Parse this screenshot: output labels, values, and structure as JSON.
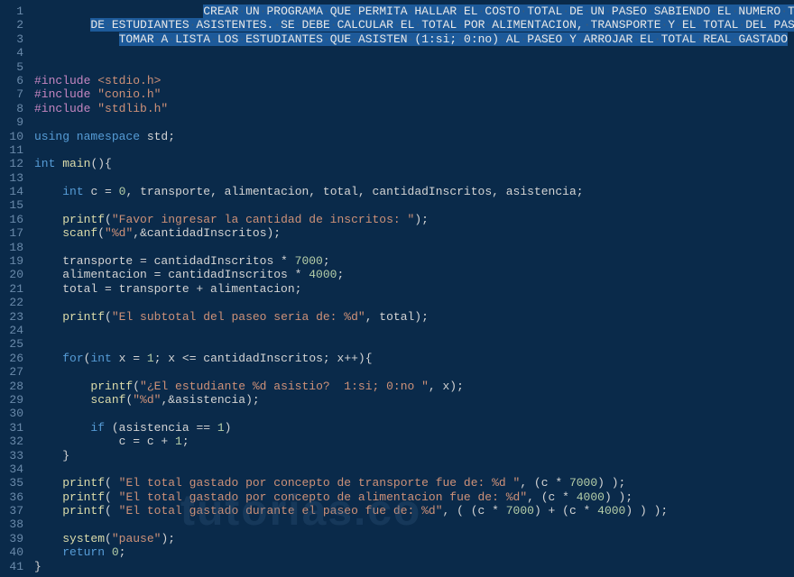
{
  "watermark": "tutorias.co",
  "lines": [
    {
      "num": 1,
      "selected": true,
      "content": [
        {
          "t": "sel",
          "v": "CREAR·UN·PROGRAMA·QUE·PERMITA·HALLAR·EL·COSTO·TOTAL·DE·UN·PASEO·SABIENDO·EL·NUMERO·TOTAL"
        }
      ],
      "indent": "                        "
    },
    {
      "num": 2,
      "selected": true,
      "content": [
        {
          "t": "sel",
          "v": "DE·ESTUDIANTES·ASISTENTES.·SE·DEBE·CALCULAR·EL·TOTAL·POR·ALIMENTACION,·TRANSPORTE·Y·EL·TOTAL·DEL·PASEO"
        }
      ],
      "indent": "        "
    },
    {
      "num": 3,
      "selected": true,
      "content": [
        {
          "t": "sel",
          "v": "TOMAR·A·LISTA·LOS·ESTUDIANTES·QUE·ASISTEN·(1:si;·0:no)·AL·PASEO·Y·ARROJAR·EL·TOTAL·REAL·GASTADO"
        }
      ],
      "indent": "            "
    },
    {
      "num": 4,
      "content": []
    },
    {
      "num": 5,
      "content": []
    },
    {
      "num": 6,
      "content": [
        {
          "t": "preproc",
          "v": "#include "
        },
        {
          "t": "include-path",
          "v": "<stdio.h>"
        }
      ]
    },
    {
      "num": 7,
      "content": [
        {
          "t": "preproc",
          "v": "#include "
        },
        {
          "t": "include-path",
          "v": "\"conio.h\""
        }
      ]
    },
    {
      "num": 8,
      "content": [
        {
          "t": "preproc",
          "v": "#include "
        },
        {
          "t": "include-path",
          "v": "\"stdlib.h\""
        }
      ]
    },
    {
      "num": 9,
      "content": []
    },
    {
      "num": 10,
      "content": [
        {
          "t": "keyword",
          "v": "using namespace "
        },
        {
          "t": "ident",
          "v": "std;"
        }
      ]
    },
    {
      "num": 11,
      "content": []
    },
    {
      "num": 12,
      "content": [
        {
          "t": "type",
          "v": "int "
        },
        {
          "t": "func",
          "v": "main"
        },
        {
          "t": "paren",
          "v": "(){"
        }
      ]
    },
    {
      "num": 13,
      "content": []
    },
    {
      "num": 14,
      "content": [
        {
          "t": "ident",
          "v": "    "
        },
        {
          "t": "type",
          "v": "int "
        },
        {
          "t": "ident",
          "v": "c = "
        },
        {
          "t": "number",
          "v": "0"
        },
        {
          "t": "ident",
          "v": ", transporte, alimentacion, total, cantidadInscritos, asistencia;"
        }
      ]
    },
    {
      "num": 15,
      "content": []
    },
    {
      "num": 16,
      "content": [
        {
          "t": "ident",
          "v": "    "
        },
        {
          "t": "func",
          "v": "printf"
        },
        {
          "t": "paren",
          "v": "("
        },
        {
          "t": "string",
          "v": "\"Favor ingresar la cantidad de inscritos: \""
        },
        {
          "t": "paren",
          "v": ");"
        }
      ]
    },
    {
      "num": 17,
      "content": [
        {
          "t": "ident",
          "v": "    "
        },
        {
          "t": "func",
          "v": "scanf"
        },
        {
          "t": "paren",
          "v": "("
        },
        {
          "t": "string",
          "v": "\"%d\""
        },
        {
          "t": "ident",
          "v": ",&cantidadInscritos);"
        }
      ]
    },
    {
      "num": 18,
      "content": []
    },
    {
      "num": 19,
      "content": [
        {
          "t": "ident",
          "v": "    transporte = cantidadInscritos * "
        },
        {
          "t": "number",
          "v": "7000"
        },
        {
          "t": "ident",
          "v": ";"
        }
      ]
    },
    {
      "num": 20,
      "content": [
        {
          "t": "ident",
          "v": "    alimentacion = cantidadInscritos * "
        },
        {
          "t": "number",
          "v": "4000"
        },
        {
          "t": "ident",
          "v": ";"
        }
      ]
    },
    {
      "num": 21,
      "content": [
        {
          "t": "ident",
          "v": "    total = transporte + alimentacion;"
        }
      ]
    },
    {
      "num": 22,
      "content": []
    },
    {
      "num": 23,
      "content": [
        {
          "t": "ident",
          "v": "    "
        },
        {
          "t": "func",
          "v": "printf"
        },
        {
          "t": "paren",
          "v": "("
        },
        {
          "t": "string",
          "v": "\"El subtotal del paseo seria de: %d\""
        },
        {
          "t": "ident",
          "v": ", total);"
        }
      ]
    },
    {
      "num": 24,
      "content": []
    },
    {
      "num": 25,
      "content": []
    },
    {
      "num": 26,
      "content": [
        {
          "t": "ident",
          "v": "    "
        },
        {
          "t": "keyword",
          "v": "for"
        },
        {
          "t": "paren",
          "v": "("
        },
        {
          "t": "type",
          "v": "int "
        },
        {
          "t": "ident",
          "v": "x = "
        },
        {
          "t": "number",
          "v": "1"
        },
        {
          "t": "ident",
          "v": "; x <= cantidadInscritos; x++){"
        }
      ]
    },
    {
      "num": 27,
      "content": []
    },
    {
      "num": 28,
      "content": [
        {
          "t": "ident",
          "v": "        "
        },
        {
          "t": "func",
          "v": "printf"
        },
        {
          "t": "paren",
          "v": "("
        },
        {
          "t": "string",
          "v": "\"¿El estudiante %d asistio?  1:si; 0:no \""
        },
        {
          "t": "ident",
          "v": ", x);"
        }
      ]
    },
    {
      "num": 29,
      "content": [
        {
          "t": "ident",
          "v": "        "
        },
        {
          "t": "func",
          "v": "scanf"
        },
        {
          "t": "paren",
          "v": "("
        },
        {
          "t": "string",
          "v": "\"%d\""
        },
        {
          "t": "ident",
          "v": ",&asistencia);"
        }
      ]
    },
    {
      "num": 30,
      "content": []
    },
    {
      "num": 31,
      "content": [
        {
          "t": "ident",
          "v": "        "
        },
        {
          "t": "keyword",
          "v": "if "
        },
        {
          "t": "paren",
          "v": "("
        },
        {
          "t": "ident",
          "v": "asistencia == "
        },
        {
          "t": "number",
          "v": "1"
        },
        {
          "t": "paren",
          "v": ")"
        }
      ]
    },
    {
      "num": 32,
      "content": [
        {
          "t": "ident",
          "v": "            c = c + "
        },
        {
          "t": "number",
          "v": "1"
        },
        {
          "t": "ident",
          "v": ";"
        }
      ]
    },
    {
      "num": 33,
      "content": [
        {
          "t": "ident",
          "v": "    }"
        }
      ]
    },
    {
      "num": 34,
      "content": []
    },
    {
      "num": 35,
      "content": [
        {
          "t": "ident",
          "v": "    "
        },
        {
          "t": "func",
          "v": "printf"
        },
        {
          "t": "paren",
          "v": "( "
        },
        {
          "t": "string",
          "v": "\"El total gastado por concepto de transporte fue de: %d \""
        },
        {
          "t": "ident",
          "v": ", (c * "
        },
        {
          "t": "number",
          "v": "7000"
        },
        {
          "t": "ident",
          "v": ") );"
        }
      ]
    },
    {
      "num": 36,
      "content": [
        {
          "t": "ident",
          "v": "    "
        },
        {
          "t": "func",
          "v": "printf"
        },
        {
          "t": "paren",
          "v": "( "
        },
        {
          "t": "string",
          "v": "\"El total gastado por concepto de alimentacion fue de: %d\""
        },
        {
          "t": "ident",
          "v": ", (c * "
        },
        {
          "t": "number",
          "v": "4000"
        },
        {
          "t": "ident",
          "v": ") );"
        }
      ]
    },
    {
      "num": 37,
      "content": [
        {
          "t": "ident",
          "v": "    "
        },
        {
          "t": "func",
          "v": "printf"
        },
        {
          "t": "paren",
          "v": "( "
        },
        {
          "t": "string",
          "v": "\"El total gastado durante el paseo fue de: %d\""
        },
        {
          "t": "ident",
          "v": ", ( (c * "
        },
        {
          "t": "number",
          "v": "7000"
        },
        {
          "t": "ident",
          "v": ") + (c * "
        },
        {
          "t": "number",
          "v": "4000"
        },
        {
          "t": "ident",
          "v": ") ) );"
        }
      ]
    },
    {
      "num": 38,
      "content": []
    },
    {
      "num": 39,
      "content": [
        {
          "t": "ident",
          "v": "    "
        },
        {
          "t": "func",
          "v": "system"
        },
        {
          "t": "paren",
          "v": "("
        },
        {
          "t": "string",
          "v": "\"pause\""
        },
        {
          "t": "paren",
          "v": ");"
        }
      ]
    },
    {
      "num": 40,
      "content": [
        {
          "t": "ident",
          "v": "    "
        },
        {
          "t": "keyword",
          "v": "return "
        },
        {
          "t": "number",
          "v": "0"
        },
        {
          "t": "ident",
          "v": ";"
        }
      ]
    },
    {
      "num": 41,
      "content": [
        {
          "t": "ident",
          "v": "}"
        }
      ]
    }
  ]
}
